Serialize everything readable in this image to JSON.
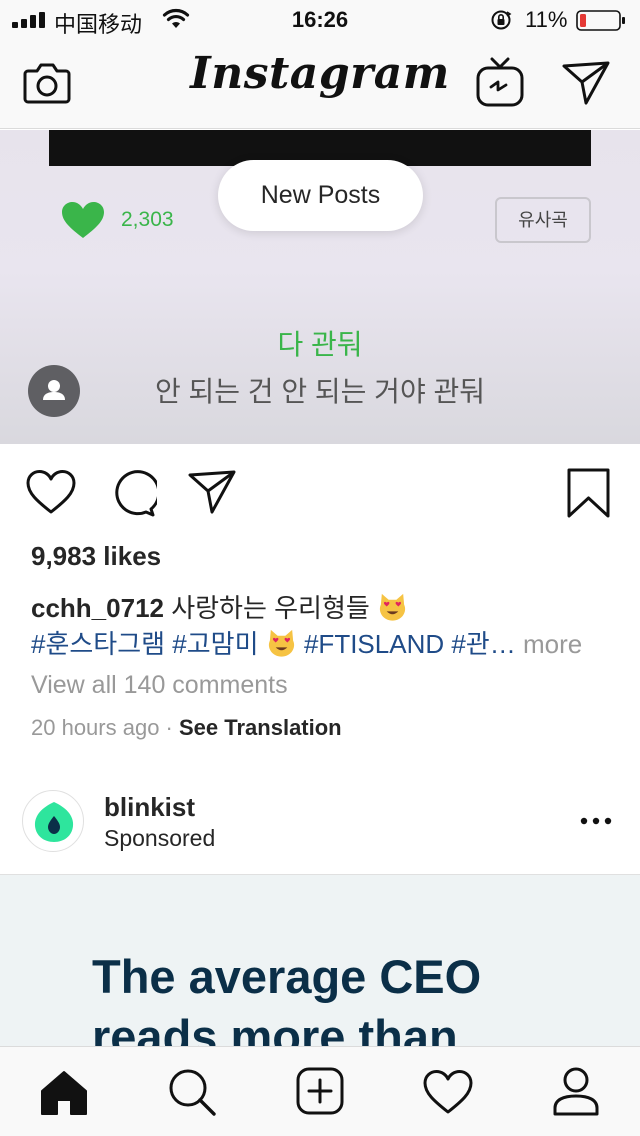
{
  "status_bar": {
    "carrier": "中国移动",
    "time": "16:26",
    "battery_percent": "11%",
    "icons": [
      "signal-icon",
      "wifi-icon",
      "orientation-lock-icon",
      "battery-icon"
    ]
  },
  "nav": {
    "logo": "Instagram",
    "icons": [
      "camera-icon",
      "igtv-icon",
      "direct-message-icon"
    ]
  },
  "post": {
    "media": {
      "like_count": "2,303",
      "similar_button": "유사곡",
      "lyric_line_1": "다 관둬",
      "lyric_line_2": "안 되는 건 안 되는 거야 관둬",
      "heart_color": "#3ab54a"
    },
    "new_posts_label": "New Posts",
    "likes": "9,983 likes",
    "caption_user": "cchh_0712",
    "caption_text": "사랑하는 우리형들",
    "hashtags_1": "#훈스타그램 #고맘미",
    "hashtags_2": " #FTISLAND #관…",
    "more_label": " more",
    "view_comments": "View all 140 comments",
    "time_ago": "20 hours ago",
    "separator": " · ",
    "see_translation": "See Translation",
    "action_icons": [
      "heart-icon",
      "comment-icon",
      "share-icon",
      "bookmark-icon"
    ]
  },
  "sponsored_post": {
    "account": "blinkist",
    "label": "Sponsored",
    "headline": "The average CEO reads more than",
    "brand_color": "#2ee59d",
    "headline_color": "#0b2f48"
  },
  "tab_bar": {
    "icons": [
      "home-icon",
      "search-icon",
      "add-post-icon",
      "activity-heart-icon",
      "profile-icon"
    ]
  },
  "colors": {
    "hashtag": "#1f4b88",
    "muted": "#999999",
    "lyric_green": "#3ab54a"
  }
}
